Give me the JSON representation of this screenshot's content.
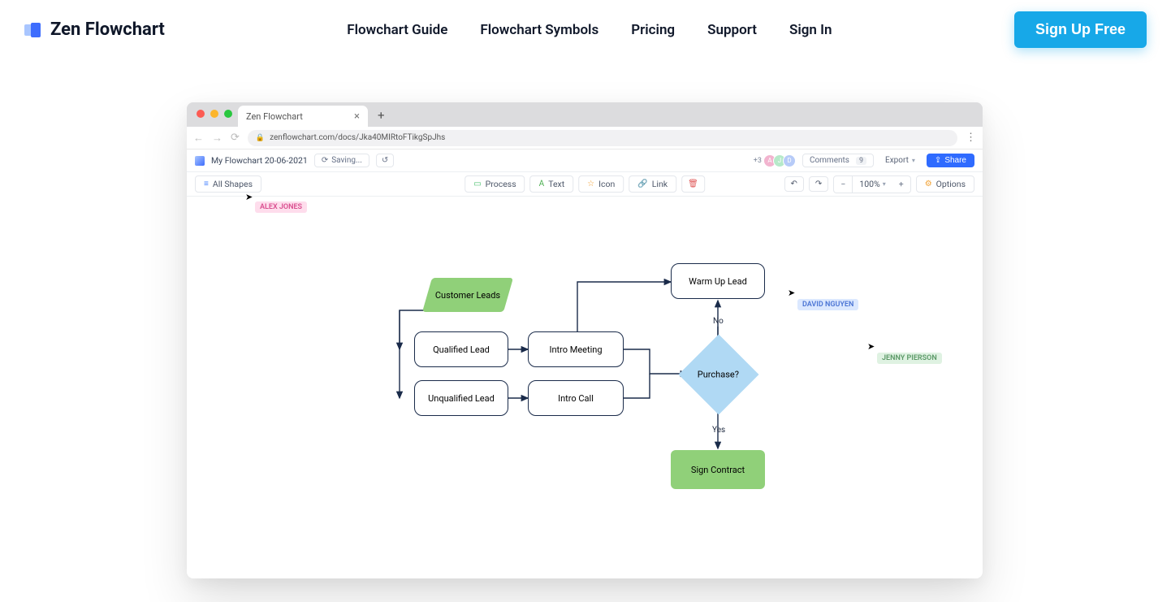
{
  "nav": {
    "brand": "Zen Flowchart",
    "links": [
      "Flowchart Guide",
      "Flowchart Symbols",
      "Pricing",
      "Support",
      "Sign In"
    ],
    "signup": "Sign Up Free"
  },
  "browser": {
    "tab_title": "Zen Flowchart",
    "url": "zenflowchart.com/docs/Jka40MIRtoFTikgSpJhs"
  },
  "appbar": {
    "doc_title": "My Flowchart 20-06-2021",
    "saving": "Saving...",
    "plus_count": "+3",
    "avatars": [
      "A",
      "J",
      "D"
    ],
    "comments_label": "Comments",
    "comments_count": "9",
    "export": "Export",
    "share": "Share"
  },
  "toolbar": {
    "all_shapes": "All Shapes",
    "process": "Process",
    "text": "Text",
    "icon": "Icon",
    "link": "Link",
    "zoom": "100%",
    "options": "Options"
  },
  "cursors": {
    "alex": "ALEX JONES",
    "david": "DAVID NGUYEN",
    "jenny": "JENNY PIERSON"
  },
  "flow": {
    "customer_leads": "Customer Leads",
    "qualified": "Qualified Lead",
    "unqualified": "Unqualified Lead",
    "intro_meeting": "Intro Meeting",
    "intro_call": "Intro Call",
    "warm_up": "Warm Up Lead",
    "purchase": "Purchase?",
    "sign": "Sign Contract",
    "yes": "Yes",
    "no": "No"
  }
}
